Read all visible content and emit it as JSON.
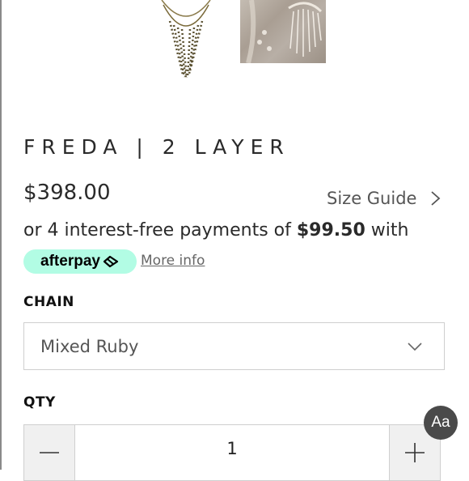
{
  "product": {
    "title": "FREDA | 2 LAYER",
    "price": "$398.00",
    "size_guide_label": "Size Guide"
  },
  "installments": {
    "prefix": "or 4 interest-free payments of ",
    "amount": "$99.50",
    "suffix": " with"
  },
  "afterpay": {
    "badge_text": "afterpay",
    "more_info": "More info",
    "badge_color": "#b2fce4"
  },
  "options": {
    "chain_label": "CHAIN",
    "chain_selected": "Mixed Ruby"
  },
  "quantity": {
    "label": "QTY",
    "value": "1"
  },
  "accessibility": {
    "font_button": "Aa"
  },
  "icons": {
    "size_guide": "chevron-right-icon",
    "select": "chevron-down-icon",
    "decrease": "minus-icon",
    "increase": "plus-icon",
    "afterpay": "afterpay-arrows-icon"
  }
}
